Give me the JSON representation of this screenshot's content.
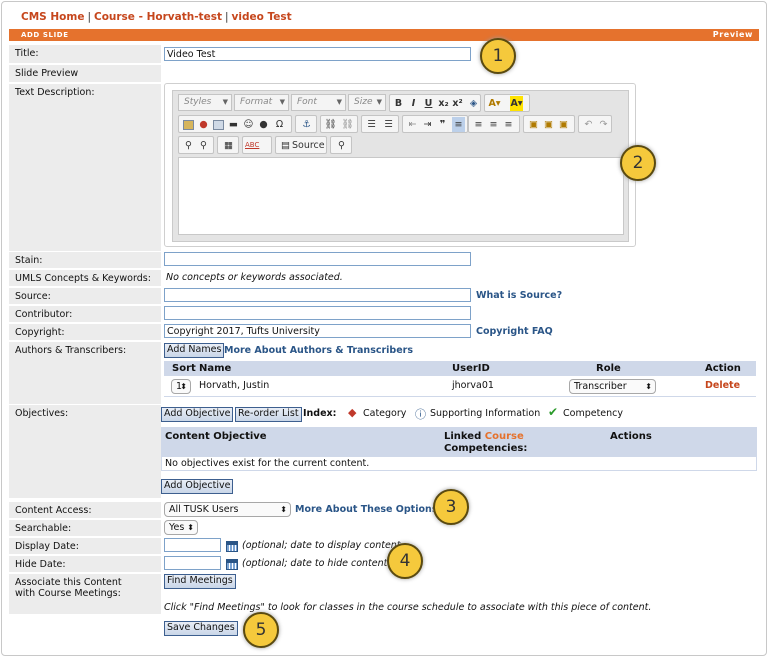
{
  "breadcrumb": {
    "home": "CMS Home",
    "sep": "|",
    "course": "Course - Horvath-test",
    "page": "video Test"
  },
  "bar": {
    "left": "ADD SLIDE",
    "right": "Preview"
  },
  "labels": {
    "title": "Title:",
    "slide_preview": "Slide Preview",
    "text_description": "Text Description:",
    "stain": "Stain:",
    "umls": "UMLS Concepts & Keywords:",
    "source": "Source:",
    "contributor": "Contributor:",
    "copyright": "Copyright:",
    "authors": "Authors & Transcribers:",
    "objectives": "Objectives:",
    "content_access": "Content Access:",
    "searchable": "Searchable:",
    "display_date": "Display Date:",
    "hide_date": "Hide Date:",
    "associate": "Associate this Content with Course Meetings:"
  },
  "fields": {
    "title": "Video Test",
    "stain": "",
    "source": "",
    "contributor": "",
    "copyright": "Copyright 2017, Tufts University",
    "display_date": "",
    "hide_date": ""
  },
  "umls_text": "No concepts or keywords associated.",
  "links": {
    "what_is_source": "What is Source?",
    "copyright_faq": "Copyright FAQ",
    "about_authors": "More About Authors & Transcribers",
    "about_options": "More About These Options"
  },
  "editor": {
    "styles": "Styles",
    "format": "Format",
    "font": "Font",
    "size": "Size",
    "bold": "B",
    "italic": "I",
    "underline": "U",
    "subscript": "x₂",
    "superscript": "x²",
    "source_button": "Source",
    "spell": "ABC"
  },
  "authors": {
    "add_button": "Add Names",
    "headers": {
      "sort": "Sort",
      "name": "Name",
      "userid": "UserID",
      "role": "Role",
      "action": "Action"
    },
    "rows": [
      {
        "sort": "1",
        "name": "Horvath, Justin",
        "userid": "jhorva01",
        "role": "Transcriber",
        "action": "Delete"
      }
    ]
  },
  "objectives": {
    "add_button": "Add Objective",
    "reorder_button": "Re-order List",
    "index_label": "Index:",
    "category": "Category",
    "supporting": "Supporting Information",
    "competency": "Competency",
    "headers": {
      "content_objective": "Content Objective",
      "linked": "Linked",
      "course": "Course",
      "competencies": "Competencies:",
      "actions": "Actions"
    },
    "empty": "No objectives exist for the current content.",
    "add_button_bottom": "Add Objective"
  },
  "access": {
    "selected": "All TUSK Users"
  },
  "searchable": {
    "selected": "Yes"
  },
  "dates": {
    "display_note": "(optional; date to display content",
    "hide_note": "(optional; date to hide content"
  },
  "meetings": {
    "button": "Find Meetings",
    "note": "Click \"Find Meetings\" to look for classes in the course schedule to associate with this piece of content."
  },
  "save_button": "Save Changes",
  "callouts": [
    "1",
    "2",
    "3",
    "4",
    "5"
  ],
  "colors": {
    "accent": "#e5722d",
    "link": "#2a5587",
    "callout": "#f5c93c",
    "danger": "#c6461c"
  }
}
